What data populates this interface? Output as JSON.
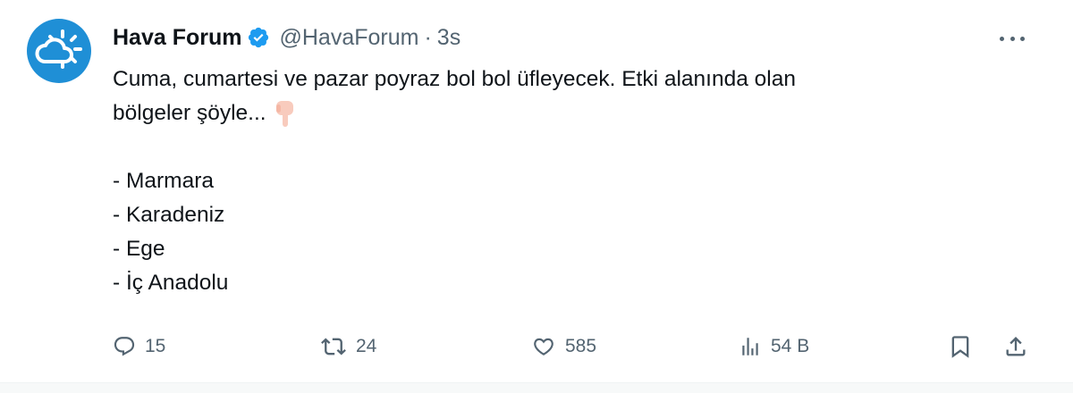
{
  "tweet": {
    "author_name": "Hava Forum",
    "handle": "@HavaForum",
    "separator": "·",
    "time": "3s",
    "text_line1": "Cuma, cumartesi ve pazar poyraz bol bol üfleyecek. Etki alanında olan",
    "text_line2": "bölgeler şöyle...",
    "regions": [
      "- Marmara",
      "- Karadeniz",
      "- Ege",
      "- İç Anadolu"
    ],
    "emoji": "pointing-down-icon"
  },
  "actions": {
    "replies": "15",
    "retweets": "24",
    "likes": "585",
    "views": "54 B"
  },
  "icons": {
    "avatar": "weather-cloud-sun-icon",
    "verified": "verified-badge-icon",
    "more": "more-options-icon",
    "reply": "reply-icon",
    "retweet": "retweet-icon",
    "like": "heart-icon",
    "views": "views-icon",
    "bookmark": "bookmark-icon",
    "share": "share-icon"
  },
  "colors": {
    "brand_blue": "#1d9bf0",
    "avatar_bg": "#1f8fd6",
    "text": "#0f1419",
    "secondary": "#536471"
  }
}
